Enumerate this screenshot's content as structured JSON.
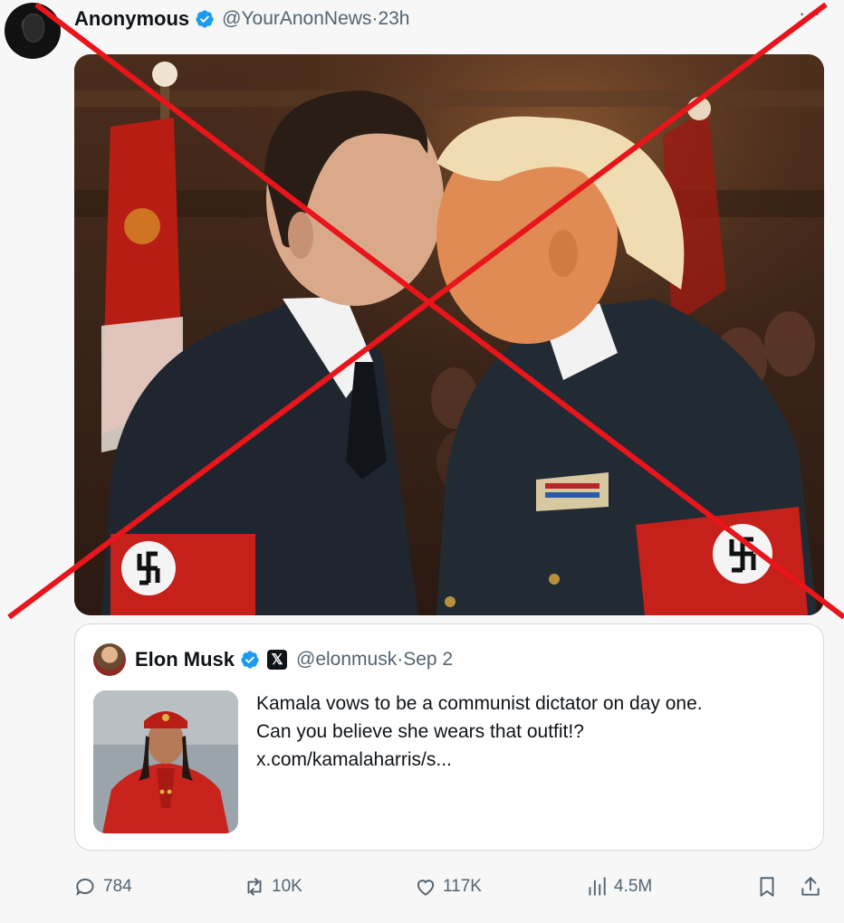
{
  "post": {
    "author_name": "Anonymous",
    "author_handle": "@YourAnonNews",
    "time": "23h",
    "handle_sep": " · ",
    "more_label": "···"
  },
  "quote": {
    "author_name": "Elon Musk",
    "x_badge": "𝕏",
    "author_handle": "@elonmusk",
    "date": "Sep 2",
    "text_lines": [
      "Kamala vows to be a communist dictator on day one.",
      "Can you believe she wears that outfit!?",
      "x.com/kamalaharris/s..."
    ]
  },
  "actions": {
    "replies": "784",
    "reposts": "10K",
    "likes": "117K",
    "views": "4.5M"
  },
  "colors": {
    "verified": "#1d9bf0",
    "cross": "#e8151b",
    "muted": "#536471"
  }
}
